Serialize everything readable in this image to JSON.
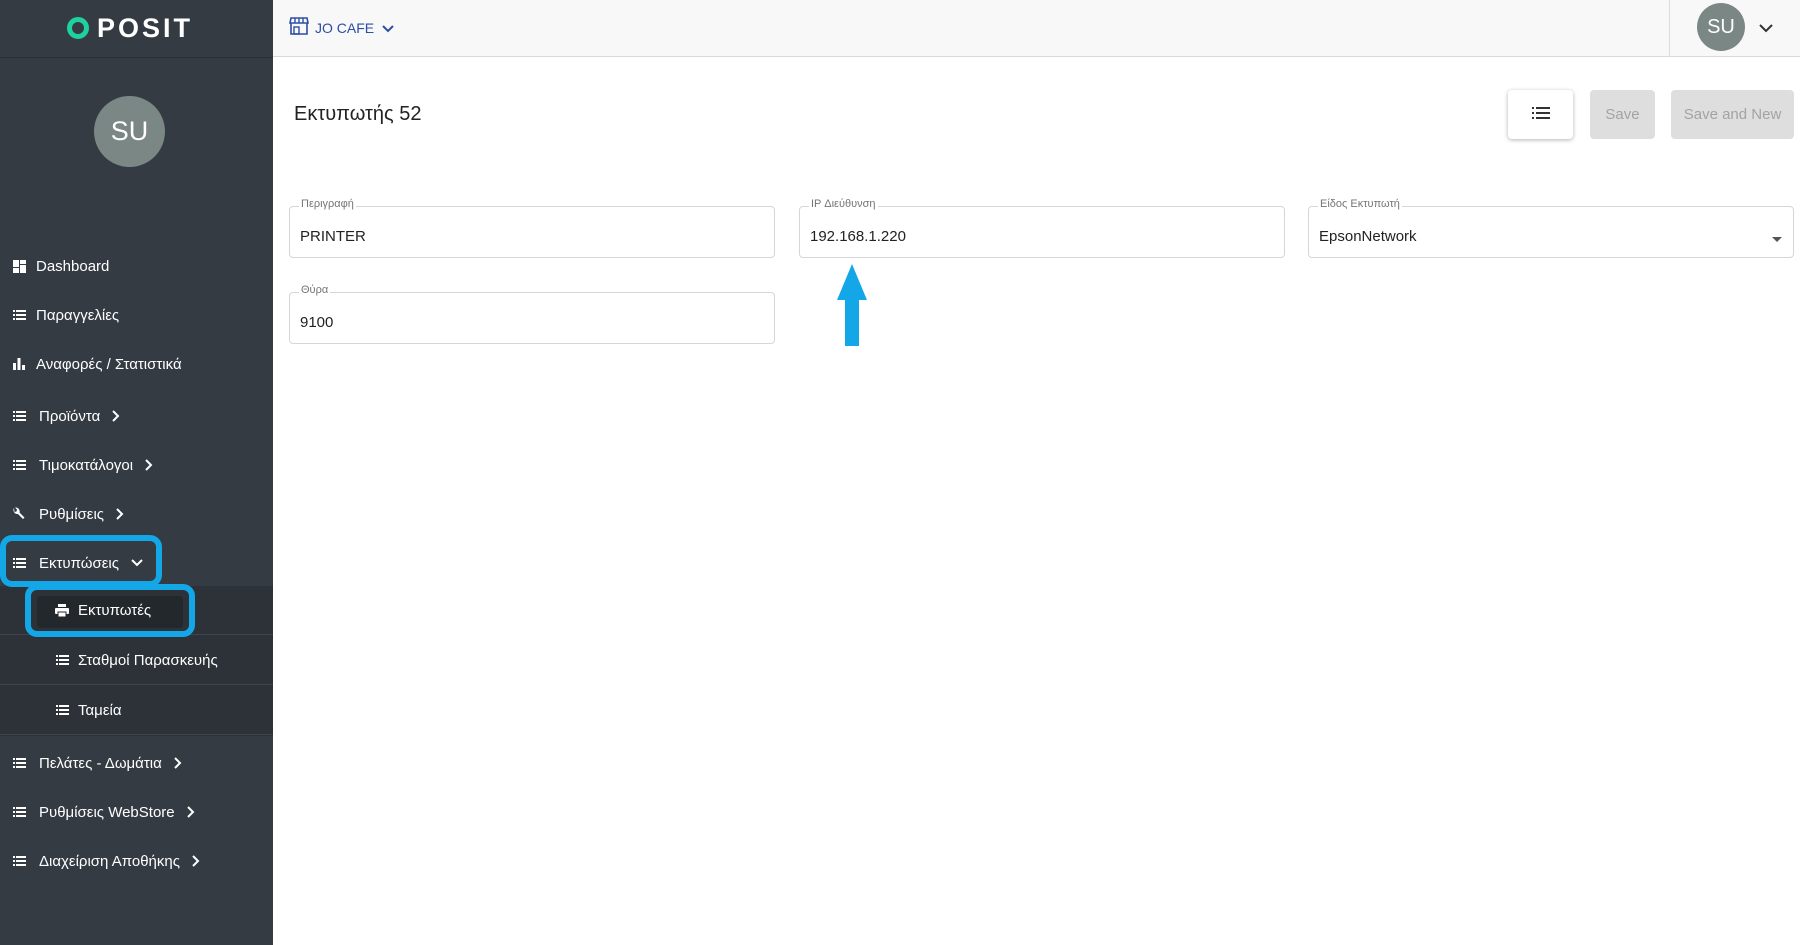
{
  "app": {
    "brand": "POSIT",
    "user_initials": "SU"
  },
  "header": {
    "store_name": "JO CAFE",
    "user_initials": "SU"
  },
  "sidebar": {
    "items": [
      {
        "label": "Dashboard",
        "icon": "dashboard-icon",
        "has_children": false
      },
      {
        "label": "Παραγγελίες",
        "icon": "list-icon",
        "has_children": false
      },
      {
        "label": "Αναφορές / Στατιστικά",
        "icon": "bar-chart-icon",
        "has_children": false
      },
      {
        "label": "Προϊόντα",
        "icon": "list-icon",
        "has_children": true
      },
      {
        "label": "Τιμοκατάλογοι",
        "icon": "list-icon",
        "has_children": true
      },
      {
        "label": "Ρυθμίσεις",
        "icon": "wrench-icon",
        "has_children": true
      },
      {
        "label": "Εκτυπώσεις",
        "icon": "list-icon",
        "has_children": true,
        "expanded": true
      },
      {
        "label": "Πελάτες - Δωμάτια",
        "icon": "list-icon",
        "has_children": true
      },
      {
        "label": "Ρυθμίσεις WebStore",
        "icon": "list-icon",
        "has_children": true
      },
      {
        "label": "Διαχείριση Αποθήκης",
        "icon": "list-icon",
        "has_children": true
      }
    ],
    "subitems": [
      {
        "label": "Εκτυπωτές",
        "icon": "printer-icon",
        "active": true
      },
      {
        "label": "Σταθμοί Παρασκευής",
        "icon": "list-icon"
      },
      {
        "label": "Ταμεία",
        "icon": "list-icon"
      }
    ]
  },
  "page": {
    "title": "Εκτυπωτής 52",
    "buttons": {
      "save": "Save",
      "save_and_new": "Save and New"
    },
    "fields": {
      "description": {
        "label": "Περιγραφή",
        "value": "PRINTER"
      },
      "ip": {
        "label": "IP Διεύθυνση",
        "value": "192.168.1.220"
      },
      "printer_type": {
        "label": "Είδος Εκτυπωτή",
        "value": "EpsonNetwork"
      },
      "port": {
        "label": "Θύρα",
        "value": "9100"
      }
    }
  },
  "colors": {
    "sidebar_bg": "#343b43",
    "accent": "#13a7e8",
    "brand_ring": "#1dd1a1",
    "link": "#2c4ea3"
  }
}
